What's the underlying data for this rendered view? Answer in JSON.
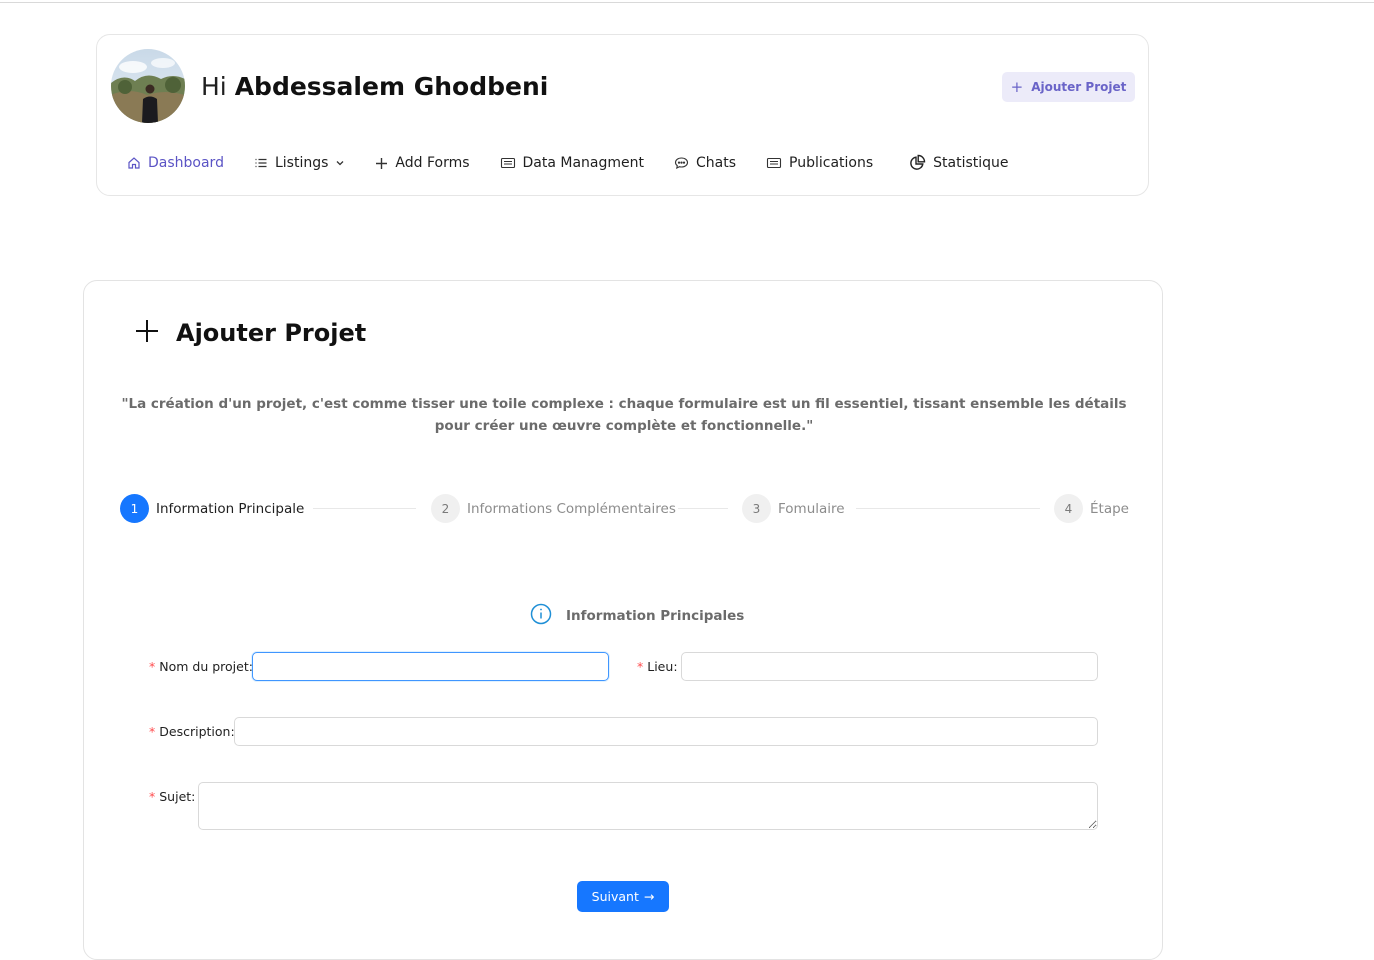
{
  "header": {
    "greeting_prefix": "Hi",
    "user_name": "Abdessalem Ghodbeni",
    "add_button_label": "Ajouter Projet"
  },
  "nav": {
    "items": [
      {
        "label": "Dashboard",
        "icon": "home-icon",
        "active": true
      },
      {
        "label": "Listings",
        "icon": "list-icon",
        "dropdown": true
      },
      {
        "label": "Add Forms",
        "icon": "plus-icon"
      },
      {
        "label": "Data Managment",
        "icon": "document-icon"
      },
      {
        "label": "Chats",
        "icon": "chat-icon"
      },
      {
        "label": "Publications",
        "icon": "document-icon"
      },
      {
        "label": "Statistique",
        "icon": "pie-chart-icon"
      }
    ]
  },
  "main": {
    "title": "Ajouter Projet",
    "quote": "\"La création d'un projet, c'est comme tisser une toile complexe : chaque formulaire est un fil essentiel, tissant ensemble les détails pour créer une œuvre complète et fonctionnelle.\"",
    "steps": [
      {
        "number": "1",
        "label": "Information Principale",
        "active": true
      },
      {
        "number": "2",
        "label": "Informations Complémentaires",
        "active": false
      },
      {
        "number": "3",
        "label": "Fomulaire",
        "active": false
      },
      {
        "number": "4",
        "label": "Étape",
        "active": false
      }
    ],
    "section_title": "Information Principales",
    "fields": {
      "nom": {
        "label": "Nom du projet",
        "value": ""
      },
      "lieu": {
        "label": "Lieu",
        "value": ""
      },
      "description": {
        "label": "Description",
        "value": ""
      },
      "sujet": {
        "label": "Sujet",
        "value": ""
      }
    },
    "required_mark": "*",
    "label_suffix": ":",
    "next_button_label": "Suivant",
    "next_button_arrow": "→"
  },
  "colors": {
    "primary": "#1677ff",
    "nav_active": "#5b54c5",
    "add_button_bg": "#ecebf9",
    "required": "#ff4d4f"
  }
}
